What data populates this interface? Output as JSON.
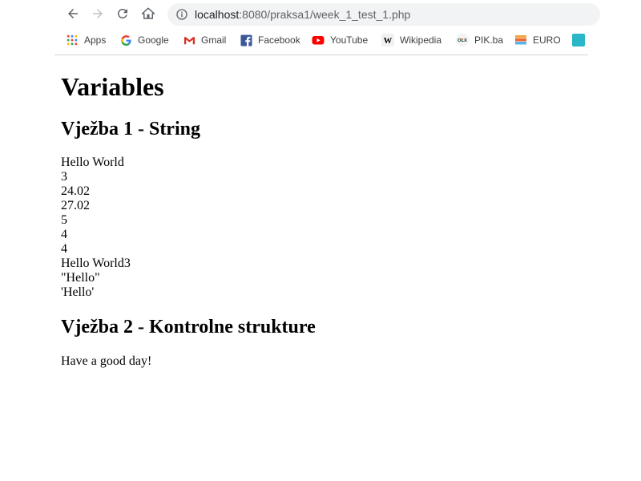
{
  "browser": {
    "url_host": "localhost",
    "url_rest": ":8080/praksa1/week_1_test_1.php",
    "bookmarks": [
      {
        "label": "Apps",
        "icon": "apps-grid-icon"
      },
      {
        "label": "Google",
        "icon": "google-icon"
      },
      {
        "label": "Gmail",
        "icon": "gmail-icon"
      },
      {
        "label": "Facebook",
        "icon": "facebook-icon"
      },
      {
        "label": "YouTube",
        "icon": "youtube-icon"
      },
      {
        "label": "Wikipedia",
        "icon": "wikipedia-icon"
      },
      {
        "label": "PIK.ba",
        "icon": "olx-icon"
      },
      {
        "label": "EURO",
        "icon": "euro-icon"
      }
    ]
  },
  "page": {
    "title": "Variables",
    "section1_heading": "Vježba 1 - String",
    "section1_output": [
      "Hello World",
      "3",
      "24.02",
      "27.02",
      "5",
      "4",
      "4",
      "Hello World3",
      "\"Hello\"",
      "'Hello'"
    ],
    "section2_heading": "Vježba 2 - Kontrolne strukture",
    "section2_output": "Have a good day!"
  },
  "colors": {
    "omnibox_bg": "#f1f3f4",
    "text": "#000000"
  }
}
